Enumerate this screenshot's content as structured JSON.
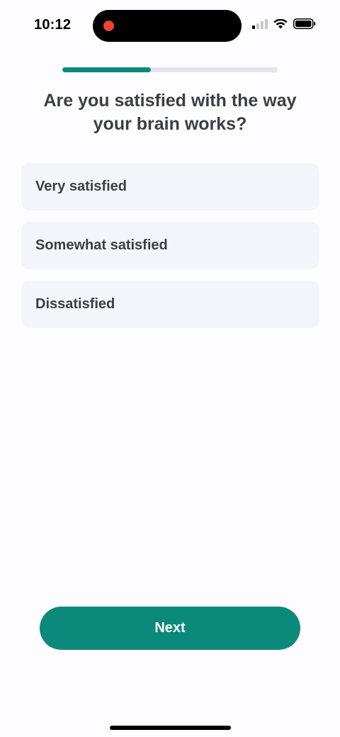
{
  "status_bar": {
    "time": "10:12",
    "icons": [
      "signal-icon",
      "wifi-icon",
      "battery-icon"
    ],
    "recording_indicator_color": "#ee4433"
  },
  "progress": {
    "fraction": 0.41,
    "fill_color": "#0b8a7b",
    "track_color": "#e3e4f0"
  },
  "question": {
    "text": "Are you satisfied with the way your brain works?"
  },
  "options": [
    {
      "label": "Very satisfied"
    },
    {
      "label": "Somewhat satisfied"
    },
    {
      "label": "Dissatisfied"
    }
  ],
  "next_button": {
    "label": "Next",
    "color": "#0b8a7b"
  }
}
